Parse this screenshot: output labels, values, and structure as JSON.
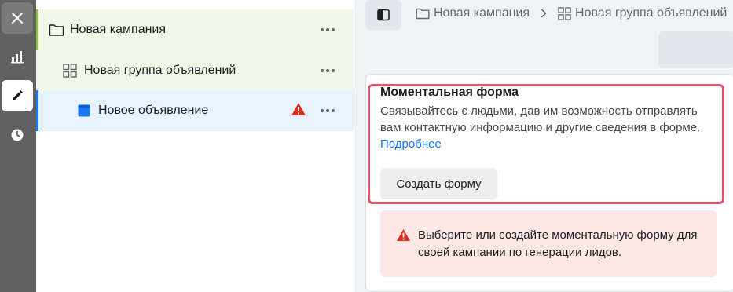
{
  "rail": {
    "items": [
      {
        "icon": "close-icon"
      },
      {
        "icon": "bar-chart-icon"
      },
      {
        "icon": "pencil-icon"
      },
      {
        "icon": "clock-icon"
      }
    ]
  },
  "tree": {
    "campaign": {
      "label": "Новая кампания",
      "icon": "folder-icon"
    },
    "adgroup": {
      "label": "Новая группа объявлений",
      "icon": "grid-icon"
    },
    "ad": {
      "label": "Новое объявление",
      "icon": "ad-icon",
      "status": "warning"
    }
  },
  "breadcrumb": {
    "items": [
      {
        "label": "Новая кампания",
        "icon": "folder-icon"
      },
      {
        "label": "Новая группа объявлений",
        "icon": "grid-icon"
      }
    ]
  },
  "instant_form": {
    "title": "Моментальная форма",
    "description": "Связывайтесь с людьми, дав им возможность отправлять вам контактную информацию и другие сведения в форме.",
    "link": "Подробнее",
    "button": "Создать форму"
  },
  "alert": {
    "text": "Выберите или создайте моментальную форму для своей кампании по генерации лидов."
  },
  "colors": {
    "rail_bg": "#606060",
    "accent_green": "#8bc34a",
    "accent_blue": "#1877f2",
    "highlight_border": "#e0546d",
    "alert_bg": "#fde8e5",
    "warning_red": "#e02d1b"
  }
}
